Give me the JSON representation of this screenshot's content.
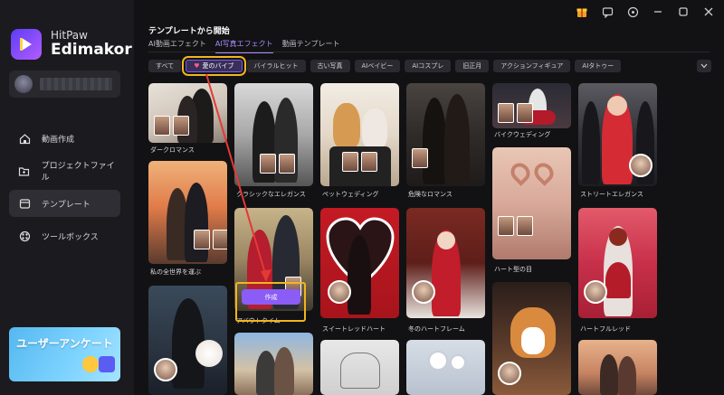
{
  "app": {
    "brand_small": "HitPaw",
    "brand_big": "Edimakor"
  },
  "sidebar": {
    "items": [
      {
        "label": "動画作成",
        "icon": "home-icon"
      },
      {
        "label": "プロジェクトファイル",
        "icon": "folder-icon"
      },
      {
        "label": "テンプレート",
        "icon": "template-icon",
        "active": true
      },
      {
        "label": "ツールボックス",
        "icon": "toolbox-icon"
      }
    ],
    "promo": "ユーザーアンケート"
  },
  "main": {
    "title": "テンプレートから開始",
    "tabs": [
      "AI動画エフェクト",
      "AI写真エフェクト",
      "動画テンプレート"
    ],
    "active_tab": 1,
    "chips": [
      "すべて",
      "愛のバイブ",
      "バイラルヒット",
      "古い写真",
      "AIベイビー",
      "AIコスプレ",
      "旧正月",
      "アクションフィギュア",
      "AIタトゥー"
    ],
    "active_chip": 1,
    "create_label": "作成",
    "cards": {
      "c1": "ダークロマンス",
      "c2": "私の全世界を運ぶ",
      "c3": "クラシックなエレガンス",
      "c4": "アバウトタイム",
      "c5": "ペットウェディング",
      "c6": "スイートレッドハート",
      "c7": "危険なロマンス",
      "c8": "冬のハートフレーム",
      "c9": "バイクウェディング",
      "c10": "ハート型の目",
      "c11": "ストリートエレガンス",
      "c12": "ハートフルレッド"
    }
  },
  "colors": {
    "accent": "#8b5cf6",
    "highlight": "#f1b61e",
    "arrow": "#e53935"
  }
}
